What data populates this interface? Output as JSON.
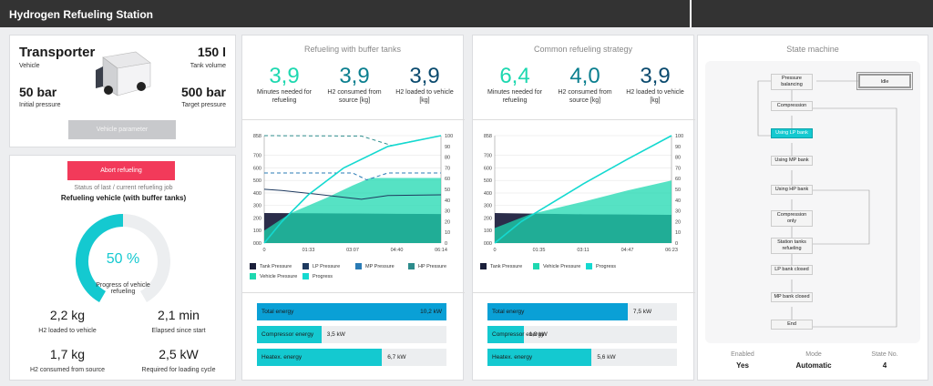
{
  "app": {
    "title": "Hydrogen Refueling Station"
  },
  "vehicle": {
    "name": "Transporter",
    "type_label": "Vehicle",
    "volume": "150 l",
    "volume_label": "Tank volume",
    "init_pressure": "50 bar",
    "init_label": "Initial pressure",
    "target_pressure": "500 bar",
    "target_label": "Target pressure",
    "param_btn": "Vehicle parameter"
  },
  "refuel": {
    "abort_btn": "Abort refueling",
    "status_label": "Status of last / current refueling job",
    "status_value": "Refueling vehicle (with buffer tanks)",
    "progress": "50 %",
    "progress_value": 50,
    "progress_label": "Progress of vehicle refueling",
    "stats": [
      {
        "value": "2,2 kg",
        "label": "H2 loaded to vehicle"
      },
      {
        "value": "2,1 min",
        "label": "Elapsed since start"
      },
      {
        "value": "1,7 kg",
        "label": "H2 consumed from source"
      },
      {
        "value": "2,5 kW",
        "label": "Required for loading cycle"
      }
    ]
  },
  "panels": [
    {
      "title": "Refueling with buffer tanks",
      "kpis": [
        {
          "value": "3,9",
          "label": "Minutes needed for refueling",
          "color": "#1ed8b0"
        },
        {
          "value": "3,9",
          "label": "H2 consumed from source [kg]",
          "color": "#0b7f8f"
        },
        {
          "value": "3,9",
          "label": "H2 loaded to vehicle [kg]",
          "color": "#0a4a6e"
        }
      ],
      "legend": [
        "Tank Pressure",
        "LP Pressure",
        "MP Pressure",
        "HP Pressure",
        "Vehicle Pressure",
        "Progress"
      ],
      "energy": [
        {
          "label": "Total energy",
          "value": "10,2 kW",
          "fraction": 1.0
        },
        {
          "label": "Compressor energy",
          "value": "3,5 kW",
          "fraction": 0.34
        },
        {
          "label": "Heatex. energy",
          "value": "6,7 kW",
          "fraction": 0.66
        }
      ]
    },
    {
      "title": "Common refueling strategy",
      "kpis": [
        {
          "value": "6,4",
          "label": "Minutes needed for refueling",
          "color": "#1ed8b0"
        },
        {
          "value": "4,0",
          "label": "H2 consumed from source [kg]",
          "color": "#0b7f8f"
        },
        {
          "value": "3,9",
          "label": "H2 loaded to vehicle [kg]",
          "color": "#0a4a6e"
        }
      ],
      "legend": [
        "Tank Pressure",
        "Vehicle Pressure",
        "Progress"
      ],
      "energy": [
        {
          "label": "Total energy",
          "value": "7,5 kW",
          "fraction": 0.74
        },
        {
          "label": "Compressor energy",
          "value": "1,9 kW",
          "fraction": 0.19
        },
        {
          "label": "Heatex. energy",
          "value": "5,6 kW",
          "fraction": 0.55
        }
      ]
    }
  ],
  "chart_data": [
    {
      "type": "line",
      "yleft_ticks": [
        "858",
        "700",
        "600",
        "500",
        "400",
        "300",
        "200",
        "100",
        "000"
      ],
      "yright_ticks": [
        "100",
        "90",
        "80",
        "70",
        "60",
        "50",
        "40",
        "30",
        "20",
        "10",
        "0"
      ],
      "x_ticks": [
        "0",
        "01:33",
        "03:07",
        "04:40",
        "06:14"
      ],
      "series": [
        {
          "name": "Tank Pressure",
          "color": "#1b1f3a",
          "x": [
            0,
            0.25,
            0.5,
            0.75,
            1
          ],
          "y": [
            240,
            238,
            236,
            234,
            232
          ]
        },
        {
          "name": "LP Pressure",
          "color": "#1e3a5f",
          "x": [
            0,
            0.1,
            0.3,
            0.55,
            0.7,
            1
          ],
          "y": [
            430,
            420,
            390,
            350,
            380,
            385
          ]
        },
        {
          "name": "MP Pressure",
          "color": "#2a7bb5",
          "x": [
            0,
            0.5,
            0.58,
            0.7,
            1
          ],
          "y": [
            560,
            560,
            505,
            560,
            560
          ]
        },
        {
          "name": "HP Pressure",
          "color": "#2d8c8c",
          "x": [
            0,
            0.55,
            0.72,
            1
          ],
          "y": [
            858,
            855,
            780,
            858
          ]
        },
        {
          "name": "Vehicle Pressure",
          "color": "#1ed8b0",
          "x": [
            0,
            0.15,
            0.35,
            0.5,
            0.6,
            1
          ],
          "y": [
            100,
            240,
            360,
            460,
            520,
            520
          ]
        },
        {
          "name": "Progress",
          "color": "#14d9d0",
          "x": [
            0,
            0.1,
            0.25,
            0.45,
            0.7,
            1
          ],
          "y": [
            0,
            20,
            45,
            70,
            90,
            100
          ]
        }
      ]
    },
    {
      "type": "line",
      "yleft_ticks": [
        "858",
        "700",
        "600",
        "500",
        "400",
        "300",
        "200",
        "100",
        "000"
      ],
      "yright_ticks": [
        "100",
        "90",
        "80",
        "70",
        "60",
        "50",
        "40",
        "30",
        "20",
        "10",
        "0"
      ],
      "x_ticks": [
        "0",
        "01:35",
        "03:11",
        "04:47",
        "06:23"
      ],
      "series": [
        {
          "name": "Tank Pressure",
          "color": "#1b1f3a",
          "x": [
            0,
            0.2,
            0.5,
            0.75,
            1
          ],
          "y": [
            240,
            235,
            230,
            228,
            225
          ]
        },
        {
          "name": "Vehicle Pressure",
          "color": "#1ed8b0",
          "x": [
            0,
            0.2,
            0.5,
            0.75,
            1
          ],
          "y": [
            120,
            230,
            330,
            420,
            500
          ]
        },
        {
          "name": "Progress",
          "color": "#14d9d0",
          "x": [
            0,
            0.15,
            0.25,
            0.5,
            0.75,
            1
          ],
          "y": [
            0,
            20,
            30,
            55,
            78,
            100
          ]
        }
      ]
    }
  ],
  "state": {
    "title": "State machine",
    "nodes": [
      "Pressure balancing",
      "Compression",
      "Using LP bank",
      "Using MP bank",
      "Using HP bank",
      "Compression only",
      "Station tanks refueling",
      "LP bank closed",
      "MP bank closed",
      "End"
    ],
    "idle": "Idle",
    "active_index": 2,
    "footer": [
      {
        "label": "Enabled",
        "value": "Yes"
      },
      {
        "label": "Mode",
        "value": "Automatic"
      },
      {
        "label": "State No.",
        "value": "4"
      }
    ]
  }
}
